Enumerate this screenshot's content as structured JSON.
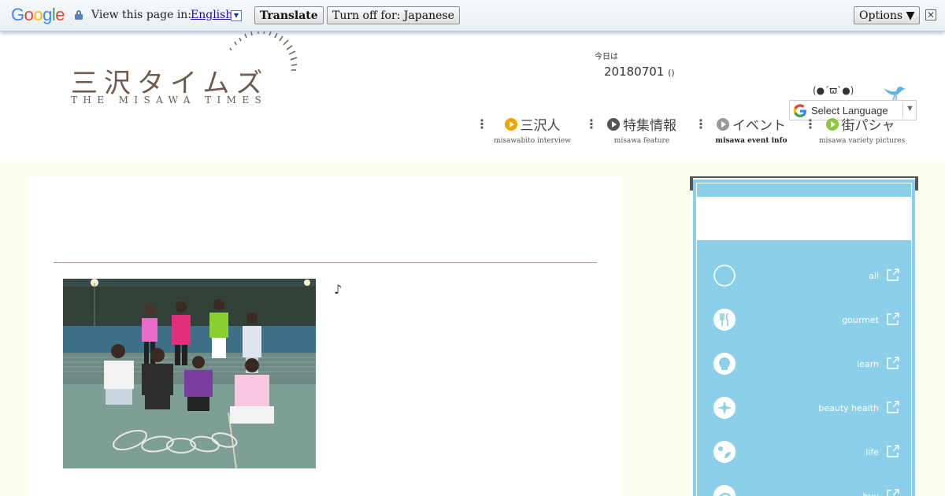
{
  "translate_bar": {
    "logo_letters": [
      {
        "ch": "G",
        "color": "#4285f4"
      },
      {
        "ch": "o",
        "color": "#ea4335"
      },
      {
        "ch": "o",
        "color": "#fbbc05"
      },
      {
        "ch": "g",
        "color": "#4285f4"
      },
      {
        "ch": "l",
        "color": "#34a853"
      },
      {
        "ch": "e",
        "color": "#ea4335"
      }
    ],
    "view_text": "View this page in:",
    "language": "English",
    "dropdown_glyph": "▼",
    "translate_button": "Translate",
    "turn_off_button": "Turn off for: Japanese",
    "options_button": "Options ▼",
    "close_glyph": "✕"
  },
  "header": {
    "logo_jp": "三沢タイムズ",
    "logo_en": "THE MISAWA TIMES",
    "today_label": "今日は",
    "today_date": "20180701",
    "today_paren": "()",
    "kaomoji": "(●´ϖ`●)",
    "select_language": "Select Language",
    "select_arrow": "▼"
  },
  "nav": [
    {
      "label": "三沢人",
      "sub": "misawabito interview",
      "dot_color": "#f0a500",
      "bold": false
    },
    {
      "label": "特集情報",
      "sub": "misawa feature",
      "dot_color": "#555555",
      "bold": false
    },
    {
      "label": "イベント",
      "sub": "misawa event info",
      "dot_color": "#999999",
      "bold": true
    },
    {
      "label": "街パシャ",
      "sub": "misawa variety pictures",
      "dot_color": "#8dc63f",
      "bold": false
    }
  ],
  "nav_dots": "⋮",
  "content": {
    "note": "♪"
  },
  "sidebar": {
    "categories": [
      {
        "label": "all",
        "icon": "circle-icon"
      },
      {
        "label": "gourmet",
        "icon": "utensils-icon"
      },
      {
        "label": "learn",
        "icon": "lightbulb-icon"
      },
      {
        "label": "beauty health",
        "icon": "sparkle-icon"
      },
      {
        "label": "life",
        "icon": "leaf-icon"
      },
      {
        "label": "buy",
        "icon": "shopping-icon"
      }
    ]
  },
  "colors": {
    "accent_blue": "#8ccfe8",
    "logo_brown": "#6e5a4e",
    "page_bg": "#fdfdf0"
  }
}
